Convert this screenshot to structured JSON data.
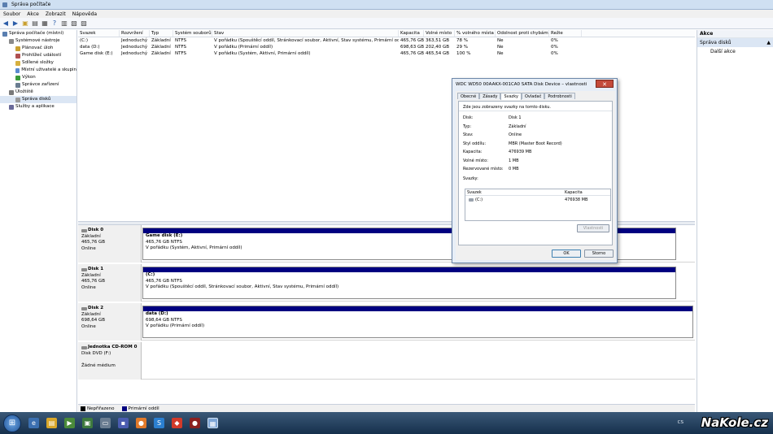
{
  "window": {
    "title": "Správa počítače"
  },
  "menu": [
    "Soubor",
    "Akce",
    "Zobrazit",
    "Nápověda"
  ],
  "tree": [
    {
      "label": "Správa počítače (místní)",
      "indent": 0,
      "icon": "computer-icon"
    },
    {
      "label": "Systémové nástroje",
      "indent": 1,
      "icon": "tools-icon"
    },
    {
      "label": "Plánovač úloh",
      "indent": 2,
      "icon": "clock-icon"
    },
    {
      "label": "Prohlížeč událostí",
      "indent": 2,
      "icon": "event-viewer-icon"
    },
    {
      "label": "Sdílené složky",
      "indent": 2,
      "icon": "folder-icon"
    },
    {
      "label": "Místní uživatelé a skupin",
      "indent": 2,
      "icon": "users-icon"
    },
    {
      "label": "Výkon",
      "indent": 2,
      "icon": "performance-icon"
    },
    {
      "label": "Správce zařízení",
      "indent": 2,
      "icon": "device-manager-icon"
    },
    {
      "label": "Úložiště",
      "indent": 1,
      "icon": "storage-icon"
    },
    {
      "label": "Správa disků",
      "indent": 2,
      "icon": "disk-management-icon"
    },
    {
      "label": "Služby a aplikace",
      "indent": 1,
      "icon": "services-icon"
    }
  ],
  "volumes": {
    "columns": [
      "Svazek",
      "Rozvržení",
      "Typ",
      "Systém souborů",
      "Stav",
      "Kapacita",
      "Volné místo",
      "% volného místa",
      "Odolnost proti chybám",
      "Režie"
    ],
    "rows": [
      [
        "(C:)",
        "Jednoduchý",
        "Základní",
        "NTFS",
        "V pořádku (Spouštěcí oddíl, Stránkovací soubor, Aktivní, Stav systému, Primární oddíl)",
        "465,76 GB",
        "363,51 GB",
        "78 %",
        "Ne",
        "0%"
      ],
      [
        "data (D:)",
        "Jednoduchý",
        "Základní",
        "NTFS",
        "V pořádku (Primární oddíl)",
        "698,63 GB",
        "202,40 GB",
        "29 %",
        "Ne",
        "0%"
      ],
      [
        "Game disk (E:)",
        "Jednoduchý",
        "Základní",
        "NTFS",
        "V pořádku (Systém, Aktivní, Primární oddíl)",
        "465,76 GB",
        "465,54 GB",
        "100 %",
        "Ne",
        "0%"
      ]
    ]
  },
  "disks": [
    {
      "name": "Disk 0",
      "type": "Základní",
      "size": "465,76 GB",
      "status": "Online",
      "part_name": "Game disk  (E:)",
      "part_size": "465,76 GB NTFS",
      "part_status": "V pořádku (Systém, Aktivní, Primární oddíl)"
    },
    {
      "name": "Disk 1",
      "type": "Základní",
      "size": "465,76 GB",
      "status": "Online",
      "part_name": "(C:)",
      "part_size": "465,76 GB NTFS",
      "part_status": "V pořádku (Spouštěcí oddíl, Stránkovací soubor, Aktivní, Stav systému, Primární oddíl)"
    },
    {
      "name": "Disk 2",
      "type": "Základní",
      "size": "698,64 GB",
      "status": "Online",
      "part_name": "data  (D:)",
      "part_size": "698,64 GB NTFS",
      "part_status": "V pořádku (Primární oddíl)"
    },
    {
      "name": "Jednotka CD-ROM 0",
      "type": "Disk DVD (F:)",
      "size": "",
      "status": "Žádné médium"
    }
  ],
  "legend": [
    {
      "label": "Nepřiřazeno",
      "color": "#000000"
    },
    {
      "label": "Primární oddíl",
      "color": "#000080"
    }
  ],
  "actions": {
    "header": "Akce",
    "section": "Správa disků",
    "item": "Další akce"
  },
  "dialog": {
    "title": "WDC WD50 00AAKX-001CA0 SATA Disk Device – vlastnosti",
    "tabs": [
      "Obecné",
      "Zásady",
      "Svazky",
      "Ovladač",
      "Podrobnosti"
    ],
    "active_tab": "Svazky",
    "info": "Zde jsou zobrazeny svazky na tomto disku.",
    "props": [
      {
        "k": "Disk:",
        "v": "Disk 1"
      },
      {
        "k": "Typ:",
        "v": "Základní"
      },
      {
        "k": "Stav:",
        "v": "Online"
      },
      {
        "k": "Styl oddílu:",
        "v": "MBR (Master Boot Record)"
      },
      {
        "k": "Kapacita:",
        "v": "476939 MB"
      },
      {
        "k": "Volné místo:",
        "v": "1 MB"
      },
      {
        "k": "Rezervované místo:",
        "v": "0 MB"
      }
    ],
    "volumes_label": "Svazky:",
    "vol_cols": [
      "Svazek",
      "Kapacita"
    ],
    "vol_rows": [
      [
        "(C:)",
        "476938 MB"
      ]
    ],
    "btn_props": "Vlastnosti",
    "btn_ok": "OK",
    "btn_cancel": "Storno"
  },
  "taskbar": {
    "lang": "CS",
    "watermark": "NaKole.cz"
  }
}
